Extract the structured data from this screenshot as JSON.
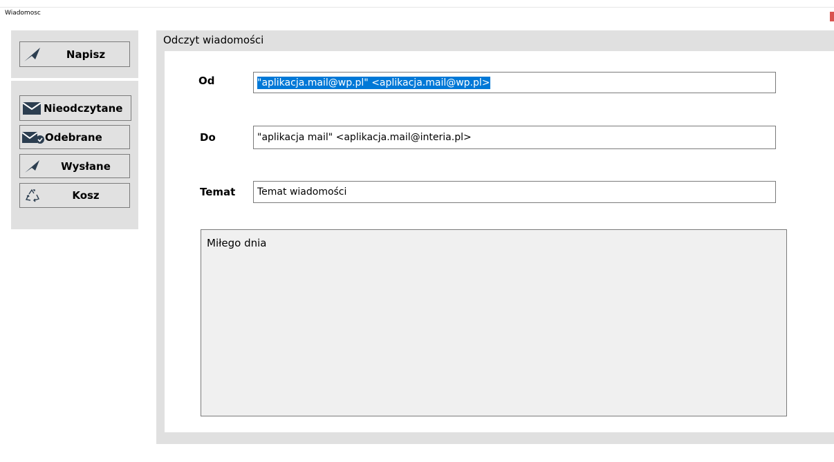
{
  "window": {
    "title": "Wiadomosc"
  },
  "sidebar": {
    "compose_label": "Napisz",
    "folders": [
      {
        "label": "Nieodczytane",
        "icon": "envelope-icon"
      },
      {
        "label": "Odebrane",
        "icon": "envelope-check-icon"
      },
      {
        "label": "Wysłane",
        "icon": "paper-plane-icon"
      },
      {
        "label": "Kosz",
        "icon": "recycle-icon"
      }
    ]
  },
  "message": {
    "panel_title": "Odczyt wiadomości",
    "from_label": "Od",
    "from_value": "\"aplikacja.mail@wp.pl\" <aplikacja.mail@wp.pl>",
    "to_label": "Do",
    "to_value": "\"aplikacja mail\" <aplikacja.mail@interia.pl>",
    "subject_label": "Temat",
    "subject_value": "Temat wiadomości",
    "body": "Miłego dnia"
  },
  "colors": {
    "panel_bg": "#e0e0e0",
    "selection": "#0078d7",
    "icon": "#2c3e50"
  }
}
